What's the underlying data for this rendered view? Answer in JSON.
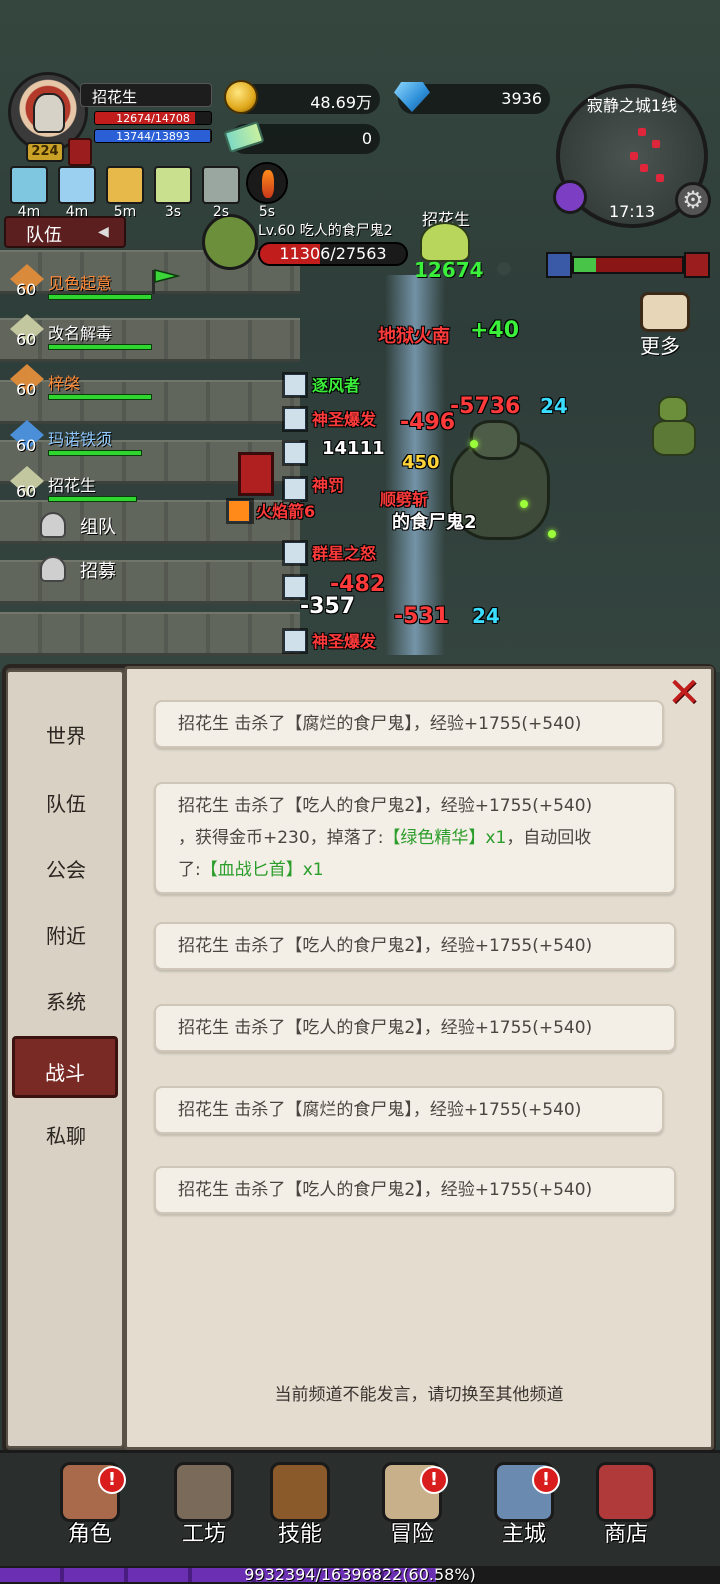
{
  "player": {
    "name": "招花生",
    "level": "224",
    "hp": "12674/14708",
    "hp_fraction": 0.862,
    "mp": "13744/13893",
    "mp_fraction": 0.989
  },
  "resources": {
    "gold": "48.69万",
    "gems": "3936",
    "tickets": "0"
  },
  "minimap": {
    "title": "寂静之城1线",
    "time": "17:13"
  },
  "buffs": [
    {
      "time": "4m",
      "color": "#7fc7e0"
    },
    {
      "time": "4m",
      "color": "#9bd0f0"
    },
    {
      "time": "5m",
      "color": "#e6b94a"
    },
    {
      "time": "3s",
      "color": "#c9e08f"
    },
    {
      "time": "2s",
      "color": "#9aa6a0"
    },
    {
      "time": "5s",
      "color": "#c9391a"
    }
  ],
  "team": {
    "tab_label": "队伍",
    "members": [
      {
        "level": "60",
        "name": "见色起意",
        "color": "#ff8c3a",
        "hp_fraction": 1.0
      },
      {
        "level": "60",
        "name": "改名解毒",
        "color": "#ffffff",
        "hp_fraction": 1.0
      },
      {
        "level": "60",
        "name": "梓棨",
        "color": "#ff8c3a",
        "hp_fraction": 1.0
      },
      {
        "level": "60",
        "name": "玛诺铁须",
        "color": "#8fc8ff",
        "hp_fraction": 0.9
      },
      {
        "level": "60",
        "name": "招花生",
        "color": "#ffffff",
        "hp_fraction": 0.86
      }
    ],
    "actions": [
      {
        "label": "组队"
      },
      {
        "label": "招募"
      }
    ]
  },
  "target": {
    "name": "Lv.60 吃人的食尸鬼2",
    "hp": "11306/27563",
    "hp_fraction": 0.41
  },
  "ally": {
    "name": "招花生",
    "hp": "12674"
  },
  "more_label": "更多",
  "combat_text": [
    {
      "text": "地狱火南",
      "color": "#ff3a3a"
    },
    {
      "text": "+40",
      "color": "#3af03a"
    },
    {
      "text": "逐风者",
      "color": "#3af03a"
    },
    {
      "text": "神圣爆发",
      "color": "#ff3a3a"
    },
    {
      "text": "-496",
      "color": "#ff3a3a"
    },
    {
      "text": "-5736",
      "color": "#ff3a3a"
    },
    {
      "text": "24",
      "color": "#3adcff"
    },
    {
      "text": "14111",
      "color": "#ffffff"
    },
    {
      "text": "450",
      "color": "#ffd53a"
    },
    {
      "text": "顺劈斩",
      "color": "#ff3a3a"
    },
    {
      "text": "火焰箭6",
      "color": "#ff3a3a"
    },
    {
      "text": "的食尸鬼2",
      "color": "#ffffff"
    },
    {
      "text": "群星之怒",
      "color": "#ff3a3a"
    },
    {
      "text": "-482",
      "color": "#ff3a3a"
    },
    {
      "text": "-357",
      "color": "#ffffff"
    },
    {
      "text": "-531",
      "color": "#ff3a3a"
    },
    {
      "text": "24",
      "color": "#3adcff"
    },
    {
      "text": "神圣爆发",
      "color": "#ff3a3a"
    },
    {
      "text": "神罚",
      "color": "#ff3a3a"
    }
  ],
  "chat": {
    "channels": [
      {
        "label": "世界"
      },
      {
        "label": "队伍"
      },
      {
        "label": "公会"
      },
      {
        "label": "附近"
      },
      {
        "label": "系统"
      },
      {
        "label": "战斗"
      },
      {
        "label": "私聊"
      }
    ],
    "active_channel": "战斗",
    "messages": [
      {
        "text": "招花生  击杀了【腐烂的食尸鬼】，经验+1755(+540)"
      },
      {
        "line1": "招花生  击杀了【吃人的食尸鬼2】，经验+1755(+540)",
        "line2a": "，获得金币+230，掉落了:",
        "line2b": "【绿色精华】x1",
        "line2c": "，自动回收",
        "line3a": "了:",
        "line3b": "【血战匕首】x1"
      },
      {
        "text": "招花生  击杀了【吃人的食尸鬼2】，经验+1755(+540)"
      },
      {
        "text": "招花生  击杀了【吃人的食尸鬼2】，经验+1755(+540)"
      },
      {
        "text": "招花生  击杀了【腐烂的食尸鬼】，经验+1755(+540)"
      },
      {
        "text": "招花生  击杀了【吃人的食尸鬼2】，经验+1755(+540)"
      }
    ],
    "notice": "当前频道不能发言，请切换至其他频道"
  },
  "nav": [
    {
      "label": "角色",
      "color": "#a86a4a",
      "alert": "!"
    },
    {
      "label": "工坊",
      "color": "#7a6a5a",
      "alert": ""
    },
    {
      "label": "技能",
      "color": "#8a5a2a",
      "alert": ""
    },
    {
      "label": "冒险",
      "color": "#c8b08a",
      "alert": "!"
    },
    {
      "label": "主城",
      "color": "#6a8ab0",
      "alert": "!"
    },
    {
      "label": "商店",
      "color": "#b03a3a",
      "alert": ""
    }
  ],
  "experience": {
    "text": "9932394/16396822(60.58%)",
    "fraction": 0.6058
  }
}
